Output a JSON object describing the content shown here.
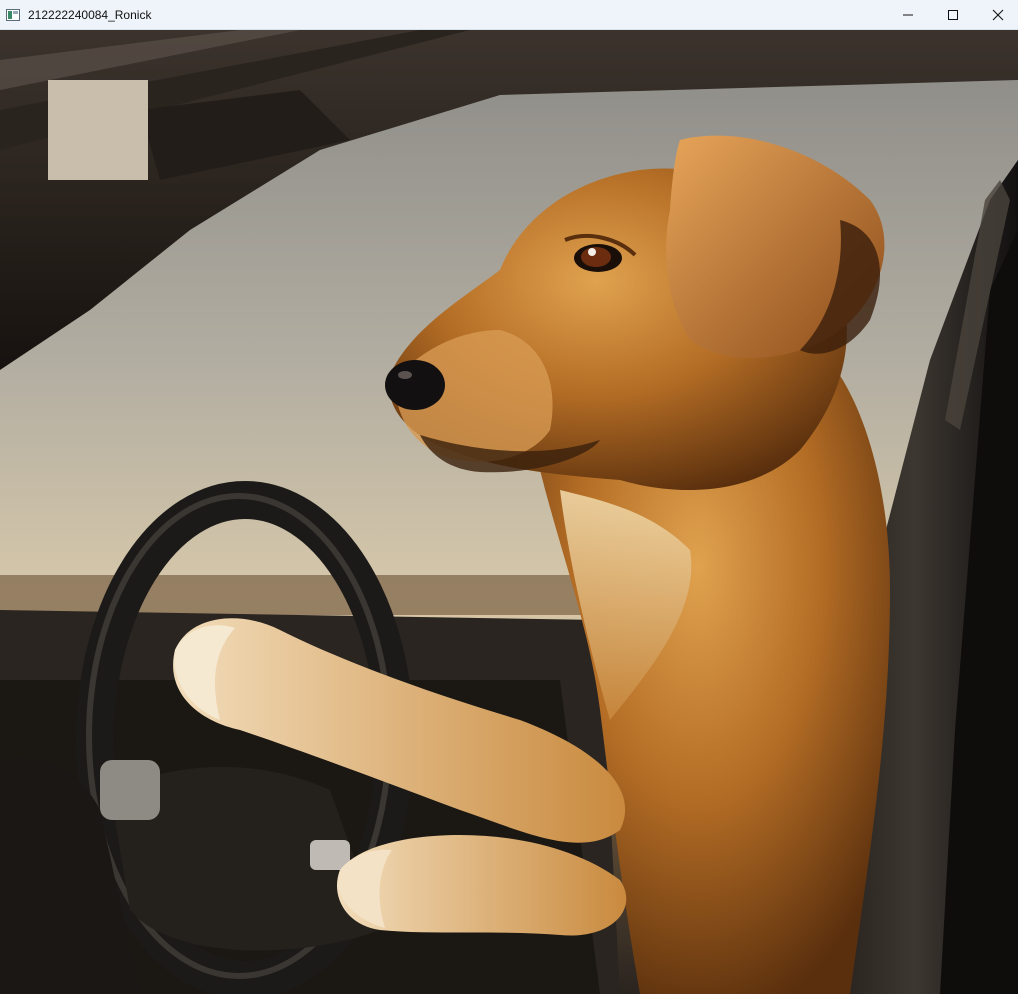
{
  "window": {
    "title": "212222240084_Ronick",
    "controls": {
      "minimize": "minimize-icon",
      "maximize": "maximize-icon",
      "close": "close-icon"
    }
  },
  "canvas": {
    "content": "photo-dog-driving-car",
    "overlay_patch": "beige-square"
  }
}
